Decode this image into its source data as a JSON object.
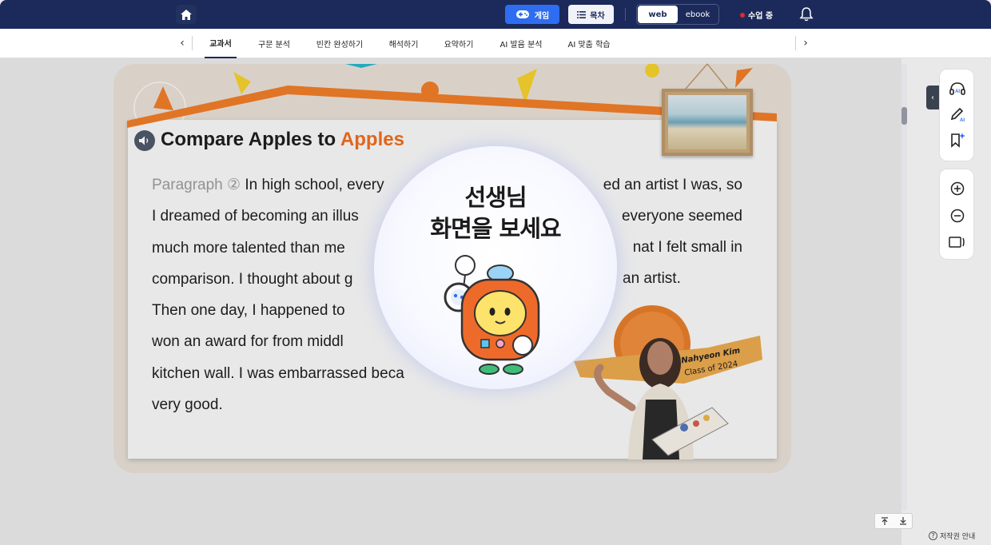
{
  "topbar": {
    "home_icon": "home-icon",
    "game_label": "게임",
    "toc_label": "목차",
    "mode_options": [
      "web",
      "ebook"
    ],
    "mode_selected": "web",
    "live_label": "수업 중",
    "colors": {
      "bar": "#1b2a5a",
      "game": "#2f6df0",
      "live_dot": "#e02a2a"
    }
  },
  "tabs": {
    "items": [
      "교과서",
      "구문 분석",
      "빈칸 완성하기",
      "해석하기",
      "요약하기",
      "AI 발음 분석",
      "AI 맞춤 학습"
    ],
    "active": "교과서"
  },
  "lesson": {
    "title_part1": "Compare Apples to ",
    "title_part2": "Apples",
    "paragraph_label": "Paragraph ②",
    "lines_left": [
      "In high school, every",
      "I dreamed of becoming an illus",
      "much more talented than me",
      "comparison. I thought about g",
      "Then one day, I happened to",
      "won  an  award  for  from  middl",
      "kitchen wall. I was embarrassed beca",
      "very good."
    ],
    "lines_right": [
      "ed an artist I was, so",
      "everyone seemed",
      "nat I felt small in",
      "an artist.",
      "",
      "",
      "",
      ""
    ],
    "accent_color": "#ee6a17"
  },
  "overlay": {
    "line1": "선생님",
    "line2": "화면을 보세요"
  },
  "profile": {
    "name": "Nahyeon Kim",
    "class": "Class of 2024"
  },
  "footer": {
    "copyright": "저작권 안내"
  }
}
